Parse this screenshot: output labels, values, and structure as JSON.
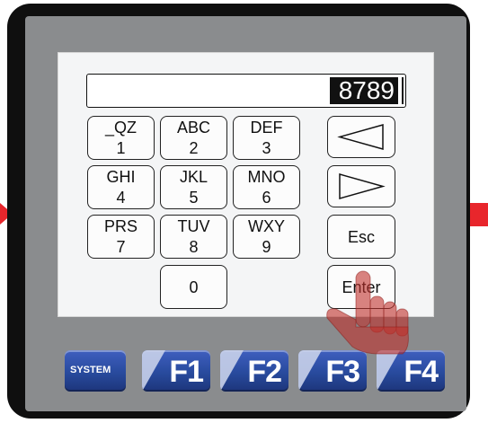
{
  "display": {
    "value": "8789"
  },
  "keypad": [
    {
      "id": "k1",
      "top": "_QZ",
      "bottom": "1"
    },
    {
      "id": "k2",
      "top": "ABC",
      "bottom": "2"
    },
    {
      "id": "k3",
      "top": "DEF",
      "bottom": "3"
    },
    {
      "id": "k4",
      "top": "GHI",
      "bottom": "4"
    },
    {
      "id": "k5",
      "top": "JKL",
      "bottom": "5"
    },
    {
      "id": "k6",
      "top": "MNO",
      "bottom": "6"
    },
    {
      "id": "k7",
      "top": "PRS",
      "bottom": "7"
    },
    {
      "id": "k8",
      "top": "TUV",
      "bottom": "8"
    },
    {
      "id": "k9",
      "top": "WXY",
      "bottom": "9"
    },
    {
      "id": "k0",
      "label": "0"
    }
  ],
  "side_keys": {
    "esc": "Esc",
    "enter": "Enter"
  },
  "function_keys": {
    "system": "SYSTEM",
    "f1": "F1",
    "f2": "F2",
    "f3": "F3",
    "f4": "F4"
  },
  "colors": {
    "marker": "#e8262c",
    "function_key": "#284a9d",
    "bezel": "#8a8c8e",
    "hand": "#c0302c"
  },
  "icons": {
    "left": "left-triangle-icon",
    "right": "right-triangle-icon",
    "pointer": "pointing-hand-icon"
  }
}
